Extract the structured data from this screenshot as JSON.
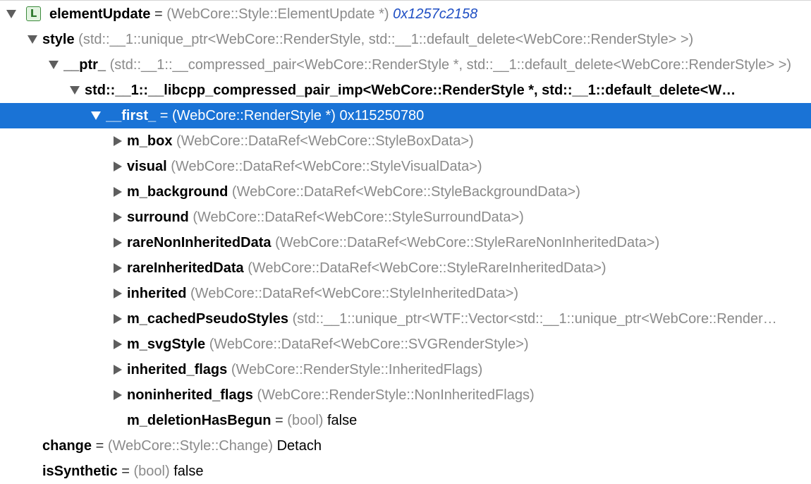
{
  "rows": [
    {
      "name": "elementUpdate",
      "sep": "=",
      "type": "(WebCore::Style::ElementUpdate *)",
      "value": "0x1257c2158",
      "expanded": true,
      "badge": "L"
    },
    {
      "name": "style",
      "sep": "",
      "type": "(std::__1::unique_ptr<WebCore::RenderStyle, std::__1::default_delete<WebCore::RenderStyle> >)",
      "value": "",
      "expanded": true
    },
    {
      "name": "__ptr_",
      "sep": "",
      "type": "(std::__1::__compressed_pair<WebCore::RenderStyle *, std::__1::default_delete<WebCore::RenderStyle> >)",
      "value": "",
      "expanded": true
    },
    {
      "name": "std::__1::__libcpp_compressed_pair_imp<WebCore::RenderStyle *, std::__1::default_delete<W…",
      "sep": "",
      "type": "",
      "value": "",
      "expanded": true
    },
    {
      "name": "__first_",
      "sep": "=",
      "type": "(WebCore::RenderStyle *)",
      "value": "0x115250780",
      "expanded": true,
      "selected": true
    },
    {
      "name": "m_box",
      "sep": "",
      "type": "(WebCore::DataRef<WebCore::StyleBoxData>)",
      "value": "",
      "expanded": false
    },
    {
      "name": "visual",
      "sep": "",
      "type": "(WebCore::DataRef<WebCore::StyleVisualData>)",
      "value": "",
      "expanded": false
    },
    {
      "name": "m_background",
      "sep": "",
      "type": "(WebCore::DataRef<WebCore::StyleBackgroundData>)",
      "value": "",
      "expanded": false
    },
    {
      "name": "surround",
      "sep": "",
      "type": "(WebCore::DataRef<WebCore::StyleSurroundData>)",
      "value": "",
      "expanded": false
    },
    {
      "name": "rareNonInheritedData",
      "sep": "",
      "type": "(WebCore::DataRef<WebCore::StyleRareNonInheritedData>)",
      "value": "",
      "expanded": false
    },
    {
      "name": "rareInheritedData",
      "sep": "",
      "type": "(WebCore::DataRef<WebCore::StyleRareInheritedData>)",
      "value": "",
      "expanded": false
    },
    {
      "name": "inherited",
      "sep": "",
      "type": "(WebCore::DataRef<WebCore::StyleInheritedData>)",
      "value": "",
      "expanded": false
    },
    {
      "name": "m_cachedPseudoStyles",
      "sep": "",
      "type": "(std::__1::unique_ptr<WTF::Vector<std::__1::unique_ptr<WebCore::Render…",
      "value": "",
      "expanded": false
    },
    {
      "name": "m_svgStyle",
      "sep": "",
      "type": "(WebCore::DataRef<WebCore::SVGRenderStyle>)",
      "value": "",
      "expanded": false
    },
    {
      "name": "inherited_flags",
      "sep": "",
      "type": "(WebCore::RenderStyle::InheritedFlags)",
      "value": "",
      "expanded": false
    },
    {
      "name": "noninherited_flags",
      "sep": "",
      "type": "(WebCore::RenderStyle::NonInheritedFlags)",
      "value": "",
      "expanded": false
    },
    {
      "name": "m_deletionHasBegun",
      "sep": "=",
      "type": "(bool)",
      "value": "false"
    },
    {
      "name": "change",
      "sep": "=",
      "type": "(WebCore::Style::Change)",
      "value": "Detach"
    },
    {
      "name": "isSynthetic",
      "sep": "=",
      "type": "(bool)",
      "value": "false"
    }
  ],
  "colors": {
    "selection": "#1a73d6",
    "type_text": "#8a8a8a",
    "address_text": "#1f4fc4",
    "badge_border": "#3c8a3c"
  },
  "icons": {
    "expanded": "disclosure-triangle-down-icon",
    "collapsed": "disclosure-triangle-right-icon",
    "badge": "local-variable-icon"
  }
}
